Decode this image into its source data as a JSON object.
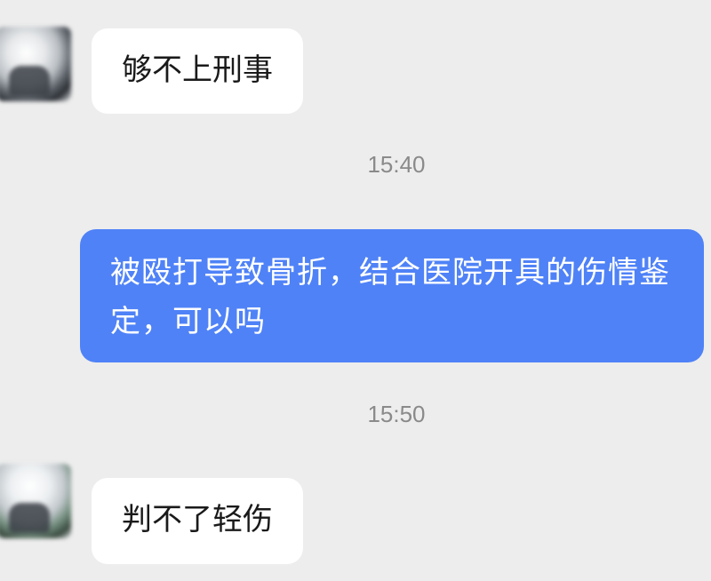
{
  "messages": [
    {
      "side": "incoming",
      "text": "够不上刑事"
    },
    {
      "time": "15:40"
    },
    {
      "side": "outgoing",
      "text": "被殴打导致骨折，结合医院开具的伤情鉴定，可以吗"
    },
    {
      "time": "15:50"
    },
    {
      "side": "incoming",
      "text": "判不了轻伤"
    }
  ],
  "colors": {
    "background": "#ededed",
    "incoming_bubble": "#ffffff",
    "outgoing_bubble": "#4f82f7",
    "timestamp": "#8a8a8a"
  }
}
